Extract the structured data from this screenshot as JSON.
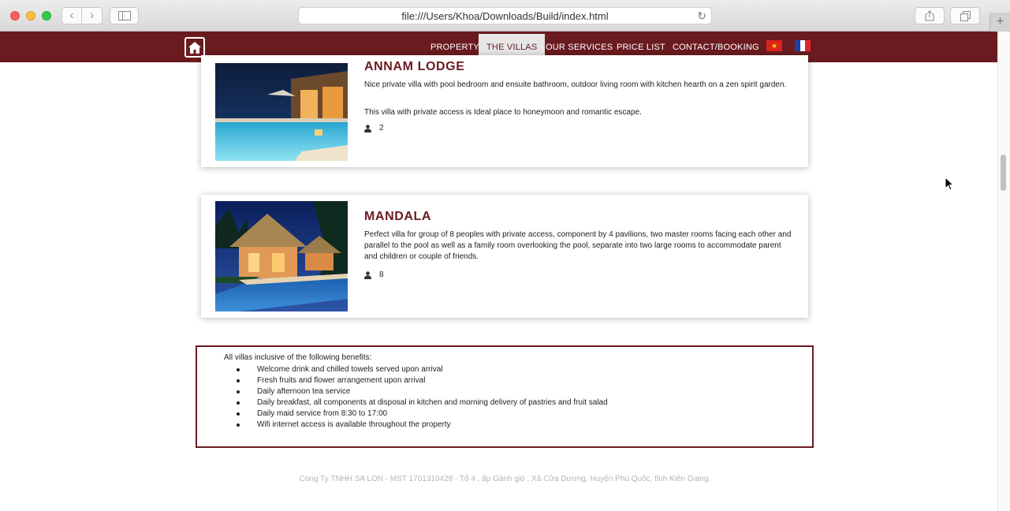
{
  "browser": {
    "url": "file:///Users/Khoa/Downloads/Build/index.html",
    "new_tab_label": "+"
  },
  "nav": {
    "items": [
      {
        "label": "PROPERTY",
        "active": false
      },
      {
        "label": "THE VILLAS",
        "active": true
      },
      {
        "label": "OUR SERVICES",
        "active": false
      },
      {
        "label": "PRICE LIST",
        "active": false
      },
      {
        "label": "CONTACT/BOOKING",
        "active": false
      }
    ],
    "languages": [
      "vietnamese-flag",
      "french-flag"
    ]
  },
  "villas": [
    {
      "title": "ANNAM LODGE",
      "desc": [
        "Nice private villa with pool bedroom and ensuite bathroom, outdoor living room with kitchen hearth on a zen spirit garden.",
        "This villa with private access is Ideal place to honeymoon and romantic escape."
      ],
      "guests": "2"
    },
    {
      "title": "MANDALA",
      "desc": [
        "Perfect villa for group of 8 peoples with private access, component by 4 pavilions, two master rooms facing each other and parallel to the pool as well as a family room overlooking the pool, separate into two large rooms to accommodate parent and children or couple of friends."
      ],
      "guests": "8"
    }
  ],
  "benefits": {
    "intro": "All villas inclusive of the following benefits:",
    "items": [
      "Welcome drink and chilled towels served upon arrival",
      "Fresh fruits and flower arrangement upon arrival",
      "Daily afternoon tea service",
      "Daily breakfast, all components at disposal in kitchen and morning delivery of pastries and fruit salad",
      "Daily maid service from 8:30 to 17:00",
      "Wifi internet access is available throughout the property"
    ]
  },
  "footer": "Cong Ty TNHH SA LON - MST 1701310428 - Tổ 4 , ấp Gành gió , Xã Cửa Dương, Huyện Phú Quốc, tỉnh Kiên Giang.",
  "colors": {
    "brand": "#6a1b1f",
    "nav_active_bg": "#e6e6e6"
  }
}
